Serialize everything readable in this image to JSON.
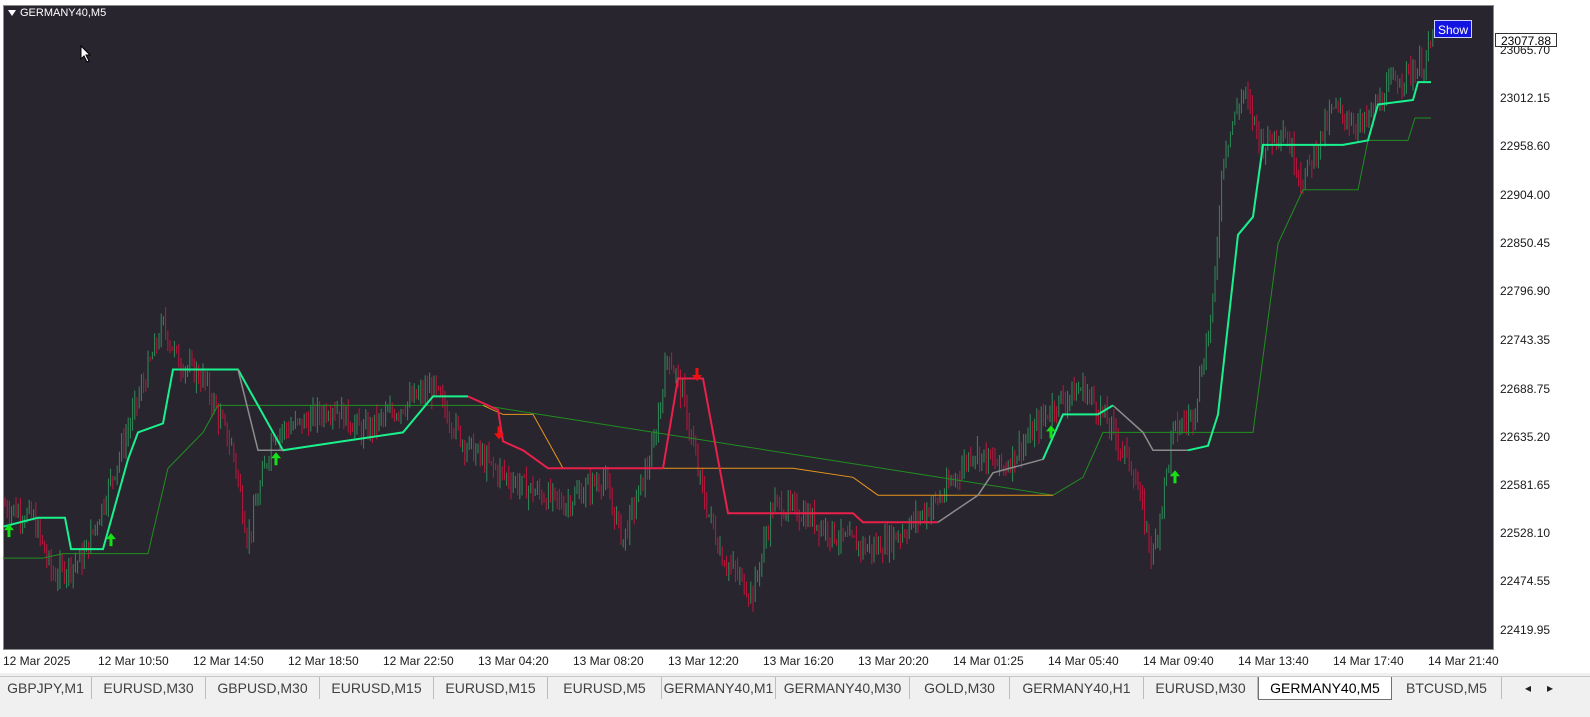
{
  "window": {
    "symbol_title": "GERMANY40,M5",
    "show_label": "Show",
    "current_price": "23077.88"
  },
  "price_axis": [
    {
      "label": "23065.70",
      "value": 23065.7
    },
    {
      "label": "23012.15",
      "value": 23012.15
    },
    {
      "label": "22958.60",
      "value": 22958.6
    },
    {
      "label": "22904.00",
      "value": 22904.0
    },
    {
      "label": "22850.45",
      "value": 22850.45
    },
    {
      "label": "22796.90",
      "value": 22796.9
    },
    {
      "label": "22743.35",
      "value": 22743.35
    },
    {
      "label": "22688.75",
      "value": 22688.75
    },
    {
      "label": "22635.20",
      "value": 22635.2
    },
    {
      "label": "22581.65",
      "value": 22581.65
    },
    {
      "label": "22528.10",
      "value": 22528.1
    },
    {
      "label": "22474.55",
      "value": 22474.55
    },
    {
      "label": "22419.95",
      "value": 22419.95
    }
  ],
  "time_axis": [
    "12 Mar 2025",
    "12 Mar 10:50",
    "12 Mar 14:50",
    "12 Mar 18:50",
    "12 Mar 22:50",
    "13 Mar 04:20",
    "13 Mar 08:20",
    "13 Mar 12:20",
    "13 Mar 16:20",
    "13 Mar 20:20",
    "14 Mar 01:25",
    "14 Mar 05:40",
    "14 Mar 09:40",
    "14 Mar 13:40",
    "14 Mar 17:40",
    "14 Mar 21:40"
  ],
  "tabs": [
    {
      "label": "GBPJPY,M1",
      "active": false
    },
    {
      "label": "EURUSD,M30",
      "active": false
    },
    {
      "label": "GBPUSD,M30",
      "active": false
    },
    {
      "label": "EURUSD,M15",
      "active": false
    },
    {
      "label": "EURUSD,M15",
      "active": false
    },
    {
      "label": "EURUSD,M5",
      "active": false
    },
    {
      "label": "GERMANY40,M1",
      "active": false
    },
    {
      "label": "GERMANY40,M30",
      "active": false
    },
    {
      "label": "GOLD,M30",
      "active": false
    },
    {
      "label": "GERMANY40,H1",
      "active": false
    },
    {
      "label": "EURUSD,M30",
      "active": false
    },
    {
      "label": "GERMANY40,M5",
      "active": true
    },
    {
      "label": "BTCUSD,M5",
      "active": false
    }
  ],
  "tab_scroll": {
    "left": "◂",
    "right": "▸"
  },
  "colors": {
    "background": "#29252f",
    "bull_candle": "#2e8b57",
    "bear_candle": "#c0143c",
    "trend_up": "#19f28c",
    "trend_down": "#e8204a",
    "trend_neutral": "#8c8c8c",
    "slow_line": "#1f8f1f",
    "resistance_line": "#e8951a",
    "buy_arrow": "#16e016",
    "sell_arrow": "#f01010"
  }
}
